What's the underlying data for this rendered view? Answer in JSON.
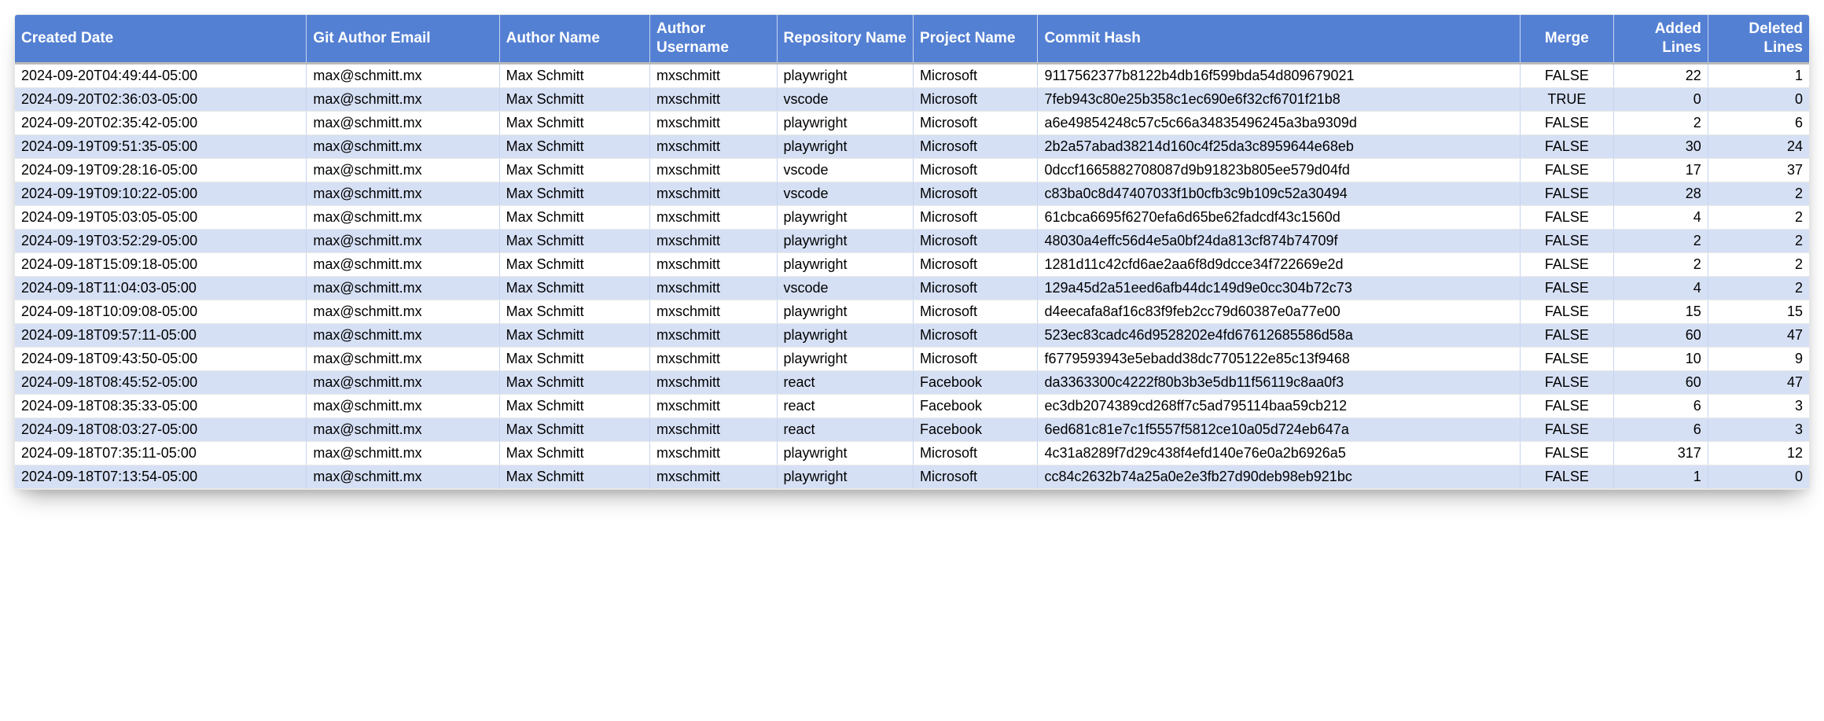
{
  "columns": [
    {
      "key": "created",
      "label": "Created Date",
      "cls": "col-created"
    },
    {
      "key": "email",
      "label": "Git Author Email",
      "cls": "col-email"
    },
    {
      "key": "author",
      "label": "Author Name",
      "cls": "col-author"
    },
    {
      "key": "username",
      "label": "Author Username",
      "cls": "col-username"
    },
    {
      "key": "repo",
      "label": "Repository Name",
      "cls": "col-repo"
    },
    {
      "key": "project",
      "label": "Project Name",
      "cls": "col-project"
    },
    {
      "key": "hash",
      "label": "Commit Hash",
      "cls": "col-hash"
    },
    {
      "key": "merge",
      "label": "Merge",
      "cls": "col-merge"
    },
    {
      "key": "added",
      "label": "Added Lines",
      "cls": "col-added"
    },
    {
      "key": "deleted",
      "label": "Deleted Lines",
      "cls": "col-deleted"
    }
  ],
  "rows": [
    {
      "created": "2024-09-20T04:49:44-05:00",
      "email": "max@schmitt.mx",
      "author": "Max Schmitt",
      "username": "mxschmitt",
      "repo": "playwright",
      "project": "Microsoft",
      "hash": "9117562377b8122b4db16f599bda54d809679021",
      "merge": "FALSE",
      "added": "22",
      "deleted": "1"
    },
    {
      "created": "2024-09-20T02:36:03-05:00",
      "email": "max@schmitt.mx",
      "author": "Max Schmitt",
      "username": "mxschmitt",
      "repo": "vscode",
      "project": "Microsoft",
      "hash": "7feb943c80e25b358c1ec690e6f32cf6701f21b8",
      "merge": "TRUE",
      "added": "0",
      "deleted": "0"
    },
    {
      "created": "2024-09-20T02:35:42-05:00",
      "email": "max@schmitt.mx",
      "author": "Max Schmitt",
      "username": "mxschmitt",
      "repo": "playwright",
      "project": "Microsoft",
      "hash": "a6e49854248c57c5c66a34835496245a3ba9309d",
      "merge": "FALSE",
      "added": "2",
      "deleted": "6"
    },
    {
      "created": "2024-09-19T09:51:35-05:00",
      "email": "max@schmitt.mx",
      "author": "Max Schmitt",
      "username": "mxschmitt",
      "repo": "playwright",
      "project": "Microsoft",
      "hash": "2b2a57abad38214d160c4f25da3c8959644e68eb",
      "merge": "FALSE",
      "added": "30",
      "deleted": "24"
    },
    {
      "created": "2024-09-19T09:28:16-05:00",
      "email": "max@schmitt.mx",
      "author": "Max Schmitt",
      "username": "mxschmitt",
      "repo": "vscode",
      "project": "Microsoft",
      "hash": "0dccf1665882708087d9b91823b805ee579d04fd",
      "merge": "FALSE",
      "added": "17",
      "deleted": "37"
    },
    {
      "created": "2024-09-19T09:10:22-05:00",
      "email": "max@schmitt.mx",
      "author": "Max Schmitt",
      "username": "mxschmitt",
      "repo": "vscode",
      "project": "Microsoft",
      "hash": "c83ba0c8d47407033f1b0cfb3c9b109c52a30494",
      "merge": "FALSE",
      "added": "28",
      "deleted": "2"
    },
    {
      "created": "2024-09-19T05:03:05-05:00",
      "email": "max@schmitt.mx",
      "author": "Max Schmitt",
      "username": "mxschmitt",
      "repo": "playwright",
      "project": "Microsoft",
      "hash": "61cbca6695f6270efa6d65be62fadcdf43c1560d",
      "merge": "FALSE",
      "added": "4",
      "deleted": "2"
    },
    {
      "created": "2024-09-19T03:52:29-05:00",
      "email": "max@schmitt.mx",
      "author": "Max Schmitt",
      "username": "mxschmitt",
      "repo": "playwright",
      "project": "Microsoft",
      "hash": "48030a4effc56d4e5a0bf24da813cf874b74709f",
      "merge": "FALSE",
      "added": "2",
      "deleted": "2"
    },
    {
      "created": "2024-09-18T15:09:18-05:00",
      "email": "max@schmitt.mx",
      "author": "Max Schmitt",
      "username": "mxschmitt",
      "repo": "playwright",
      "project": "Microsoft",
      "hash": "1281d11c42cfd6ae2aa6f8d9dcce34f722669e2d",
      "merge": "FALSE",
      "added": "2",
      "deleted": "2"
    },
    {
      "created": "2024-09-18T11:04:03-05:00",
      "email": "max@schmitt.mx",
      "author": "Max Schmitt",
      "username": "mxschmitt",
      "repo": "vscode",
      "project": "Microsoft",
      "hash": "129a45d2a51eed6afb44dc149d9e0cc304b72c73",
      "merge": "FALSE",
      "added": "4",
      "deleted": "2"
    },
    {
      "created": "2024-09-18T10:09:08-05:00",
      "email": "max@schmitt.mx",
      "author": "Max Schmitt",
      "username": "mxschmitt",
      "repo": "playwright",
      "project": "Microsoft",
      "hash": "d4eecafa8af16c83f9feb2cc79d60387e0a77e00",
      "merge": "FALSE",
      "added": "15",
      "deleted": "15"
    },
    {
      "created": "2024-09-18T09:57:11-05:00",
      "email": "max@schmitt.mx",
      "author": "Max Schmitt",
      "username": "mxschmitt",
      "repo": "playwright",
      "project": "Microsoft",
      "hash": "523ec83cadc46d9528202e4fd67612685586d58a",
      "merge": "FALSE",
      "added": "60",
      "deleted": "47"
    },
    {
      "created": "2024-09-18T09:43:50-05:00",
      "email": "max@schmitt.mx",
      "author": "Max Schmitt",
      "username": "mxschmitt",
      "repo": "playwright",
      "project": "Microsoft",
      "hash": "f6779593943e5ebadd38dc7705122e85c13f9468",
      "merge": "FALSE",
      "added": "10",
      "deleted": "9"
    },
    {
      "created": "2024-09-18T08:45:52-05:00",
      "email": "max@schmitt.mx",
      "author": "Max Schmitt",
      "username": "mxschmitt",
      "repo": "react",
      "project": "Facebook",
      "hash": "da3363300c4222f80b3b3e5db11f56119c8aa0f3",
      "merge": "FALSE",
      "added": "60",
      "deleted": "47"
    },
    {
      "created": "2024-09-18T08:35:33-05:00",
      "email": "max@schmitt.mx",
      "author": "Max Schmitt",
      "username": "mxschmitt",
      "repo": "react",
      "project": "Facebook",
      "hash": "ec3db2074389cd268ff7c5ad795114baa59cb212",
      "merge": "FALSE",
      "added": "6",
      "deleted": "3"
    },
    {
      "created": "2024-09-18T08:03:27-05:00",
      "email": "max@schmitt.mx",
      "author": "Max Schmitt",
      "username": "mxschmitt",
      "repo": "react",
      "project": "Facebook",
      "hash": "6ed681c81e7c1f5557f5812ce10a05d724eb647a",
      "merge": "FALSE",
      "added": "6",
      "deleted": "3"
    },
    {
      "created": "2024-09-18T07:35:11-05:00",
      "email": "max@schmitt.mx",
      "author": "Max Schmitt",
      "username": "mxschmitt",
      "repo": "playwright",
      "project": "Microsoft",
      "hash": "4c31a8289f7d29c438f4efd140e76e0a2b6926a5",
      "merge": "FALSE",
      "added": "317",
      "deleted": "12"
    },
    {
      "created": "2024-09-18T07:13:54-05:00",
      "email": "max@schmitt.mx",
      "author": "Max Schmitt",
      "username": "mxschmitt",
      "repo": "playwright",
      "project": "Microsoft",
      "hash": "cc84c2632b74a25a0e2e3fb27d90deb98eb921bc",
      "merge": "FALSE",
      "added": "1",
      "deleted": "0"
    }
  ]
}
